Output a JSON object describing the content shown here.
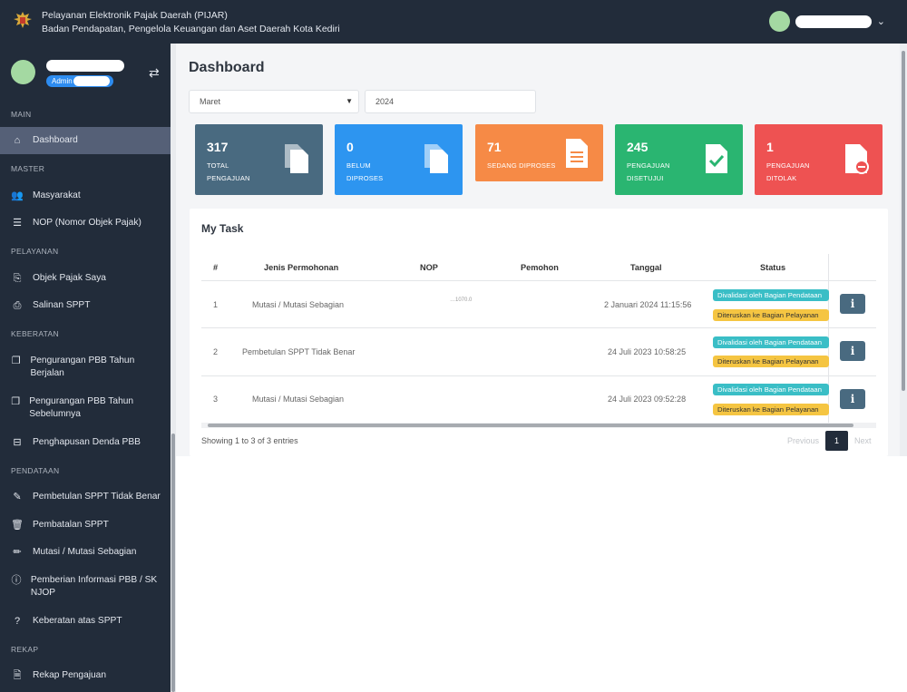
{
  "header": {
    "title_line1": "Pelayanan Elektronik Pajak Daerah (PIJAR)",
    "title_line2": "Badan Pendapatan, Pengelola Keuangan dan Aset Daerah Kota Kediri",
    "logo_icon": "garuda-emblem-icon",
    "user_menu_icon": "chevron-down-icon"
  },
  "profile": {
    "role": "Admin",
    "switch_icon": "swap-icon"
  },
  "sidebar": {
    "sections": {
      "main": "MAIN",
      "master": "MASTER",
      "pelayanan": "PELAYANAN",
      "keberatan": "KEBERATAN",
      "pendataan": "PENDATAAN",
      "rekap": "REKAP"
    },
    "items": [
      {
        "label": "Dashboard",
        "icon": "home-icon"
      },
      {
        "label": "Masyarakat",
        "icon": "users-icon"
      },
      {
        "label": "NOP (Nomor Objek Pajak)",
        "icon": "list-icon"
      },
      {
        "label": "Objek Pajak Saya",
        "icon": "file-export-icon"
      },
      {
        "label": "Salinan SPPT",
        "icon": "file-download-icon"
      },
      {
        "label": "Pengurangan PBB Tahun Berjalan",
        "icon": "copy-icon"
      },
      {
        "label": "Pengurangan PBB Tahun Sebelumnya",
        "icon": "copy-icon"
      },
      {
        "label": "Penghapusan Denda PBB",
        "icon": "money-icon"
      },
      {
        "label": "Pembetulan SPPT Tidak Benar",
        "icon": "edit-icon"
      },
      {
        "label": "Pembatalan SPPT",
        "icon": "trash-icon"
      },
      {
        "label": "Mutasi / Mutasi Sebagian",
        "icon": "pencil-icon"
      },
      {
        "label": "Pemberian Informasi PBB / SK NJOP",
        "icon": "info-circle-icon"
      },
      {
        "label": "Keberatan atas SPPT",
        "icon": "question-circle-icon"
      },
      {
        "label": "Rekap Pengajuan",
        "icon": "file-alt-icon"
      }
    ]
  },
  "main": {
    "title": "Dashboard",
    "month_select": "Maret",
    "year_input": "2024"
  },
  "cards": [
    {
      "value": "317",
      "label1": "TOTAL",
      "label2": "PENGAJUAN",
      "color": "#496a80",
      "icon": "files-icon"
    },
    {
      "value": "0",
      "label1": "BELUM",
      "label2": "DIPROSES",
      "color": "#2d95f0",
      "icon": "files-icon"
    },
    {
      "value": "71",
      "label1": "SEDANG DIPROSES",
      "label2": "",
      "color": "#f68a46",
      "icon": "document-icon"
    },
    {
      "value": "245",
      "label1": "PENGAJUAN",
      "label2": "DISETUJUI",
      "color": "#2ab571",
      "icon": "document-check-icon"
    },
    {
      "value": "1",
      "label1": "PENGAJUAN",
      "label2": "DITOLAK",
      "color": "#ee5252",
      "icon": "document-minus-icon"
    }
  ],
  "task": {
    "title": "My Task",
    "columns": [
      "#",
      "Jenis Permohonan",
      "NOP",
      "Pemohon",
      "Tanggal",
      "Status"
    ],
    "rows": [
      {
        "no": "1",
        "jenis": "Mutasi / Mutasi Sebagian",
        "nop": "…1070.0",
        "tanggal": "2 Januari 2024 11:15:56",
        "status1": "Divalidasi oleh Bagian Pendataan",
        "status2": "Diteruskan ke Bagian Pelayanan"
      },
      {
        "no": "2",
        "jenis": "Pembetulan SPPT Tidak Benar",
        "nop": "",
        "tanggal": "24 Juli 2023 10:58:25",
        "status1": "Divalidasi oleh Bagian Pendataan",
        "status2": "Diteruskan ke Bagian Pelayanan"
      },
      {
        "no": "3",
        "jenis": "Mutasi / Mutasi Sebagian",
        "nop": "",
        "tanggal": "24 Juli 2023 09:52:28",
        "status1": "Divalidasi oleh Bagian Pendataan",
        "status2": "Diteruskan ke Bagian Pelayanan"
      }
    ],
    "info_label": "i",
    "footer": "Showing 1 to 3 of 3 entries",
    "prev": "Previous",
    "page": "1",
    "next": "Next"
  }
}
